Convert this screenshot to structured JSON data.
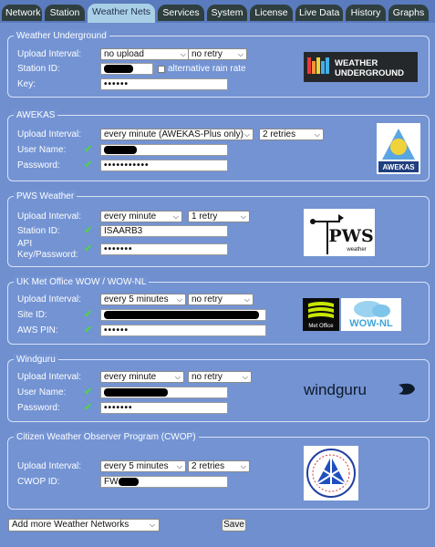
{
  "tabs": [
    {
      "label": "Network",
      "active": false
    },
    {
      "label": "Station",
      "active": false
    },
    {
      "label": "Weather Nets",
      "active": true
    },
    {
      "label": "Services",
      "active": false
    },
    {
      "label": "System",
      "active": false
    },
    {
      "label": "License",
      "active": false
    },
    {
      "label": "Live Data",
      "active": false
    },
    {
      "label": "History",
      "active": false
    },
    {
      "label": "Graphs",
      "active": false
    }
  ],
  "wunderground": {
    "title": "Weather Underground",
    "upload_interval_label": "Upload Interval:",
    "upload_interval_value": "no upload",
    "retry_value": "no retry",
    "station_id_label": "Station ID:",
    "alt_rain_label": "alternative rain rate",
    "key_label": "Key:",
    "key_value": "••••••",
    "logo_text_1": "WEATHER",
    "logo_text_2": "UNDERGROUND"
  },
  "awekas": {
    "title": "AWEKAS",
    "upload_interval_label": "Upload Interval:",
    "upload_interval_value": "every minute (AWEKAS-Plus only)",
    "retry_value": "2 retries",
    "user_name_label": "User Name:",
    "password_label": "Password:",
    "password_value": "•••••••••••",
    "logo_text": "AWEKAS"
  },
  "pws": {
    "title": "PWS Weather",
    "upload_interval_label": "Upload Interval:",
    "upload_interval_value": "every minute",
    "retry_value": "1 retry",
    "station_id_label": "Station ID:",
    "station_id_value": "ISAARB3",
    "api_key_label_1": "API",
    "api_key_label_2": "Key/Password:",
    "api_key_value": "•••••••",
    "logo_text": "PWS",
    "logo_subtext": "weather"
  },
  "ukmet": {
    "title": "UK Met Office WOW / WOW-NL",
    "upload_interval_label": "Upload Interval:",
    "upload_interval_value": "every 5 minutes",
    "retry_value": "no retry",
    "site_id_label": "Site ID:",
    "aws_pin_label": "AWS PIN:",
    "aws_pin_value": "••••••",
    "logo_metoffice": "Met Office",
    "logo_wownl": "WOW-NL"
  },
  "windguru": {
    "title": "Windguru",
    "upload_interval_label": "Upload Interval:",
    "upload_interval_value": "every minute",
    "retry_value": "no retry",
    "user_name_label": "User Name:",
    "password_label": "Password:",
    "password_value": "•••••••",
    "logo_text": "windguru"
  },
  "cwop": {
    "title": "Citizen Weather Observer Program (CWOP)",
    "upload_interval_label": "Upload Interval:",
    "upload_interval_value": "every 5 minutes",
    "retry_value": "2 retries",
    "cwop_id_label": "CWOP ID:",
    "cwop_id_value": "FW"
  },
  "footer": {
    "add_more_value": "Add more Weather Networks",
    "save_label": "Save"
  },
  "colors": {
    "background": "#6f8fcf",
    "tab_dark": "#2f3f3f",
    "tab_active": "#a9cfe6",
    "check_green": "#4fd14f"
  }
}
